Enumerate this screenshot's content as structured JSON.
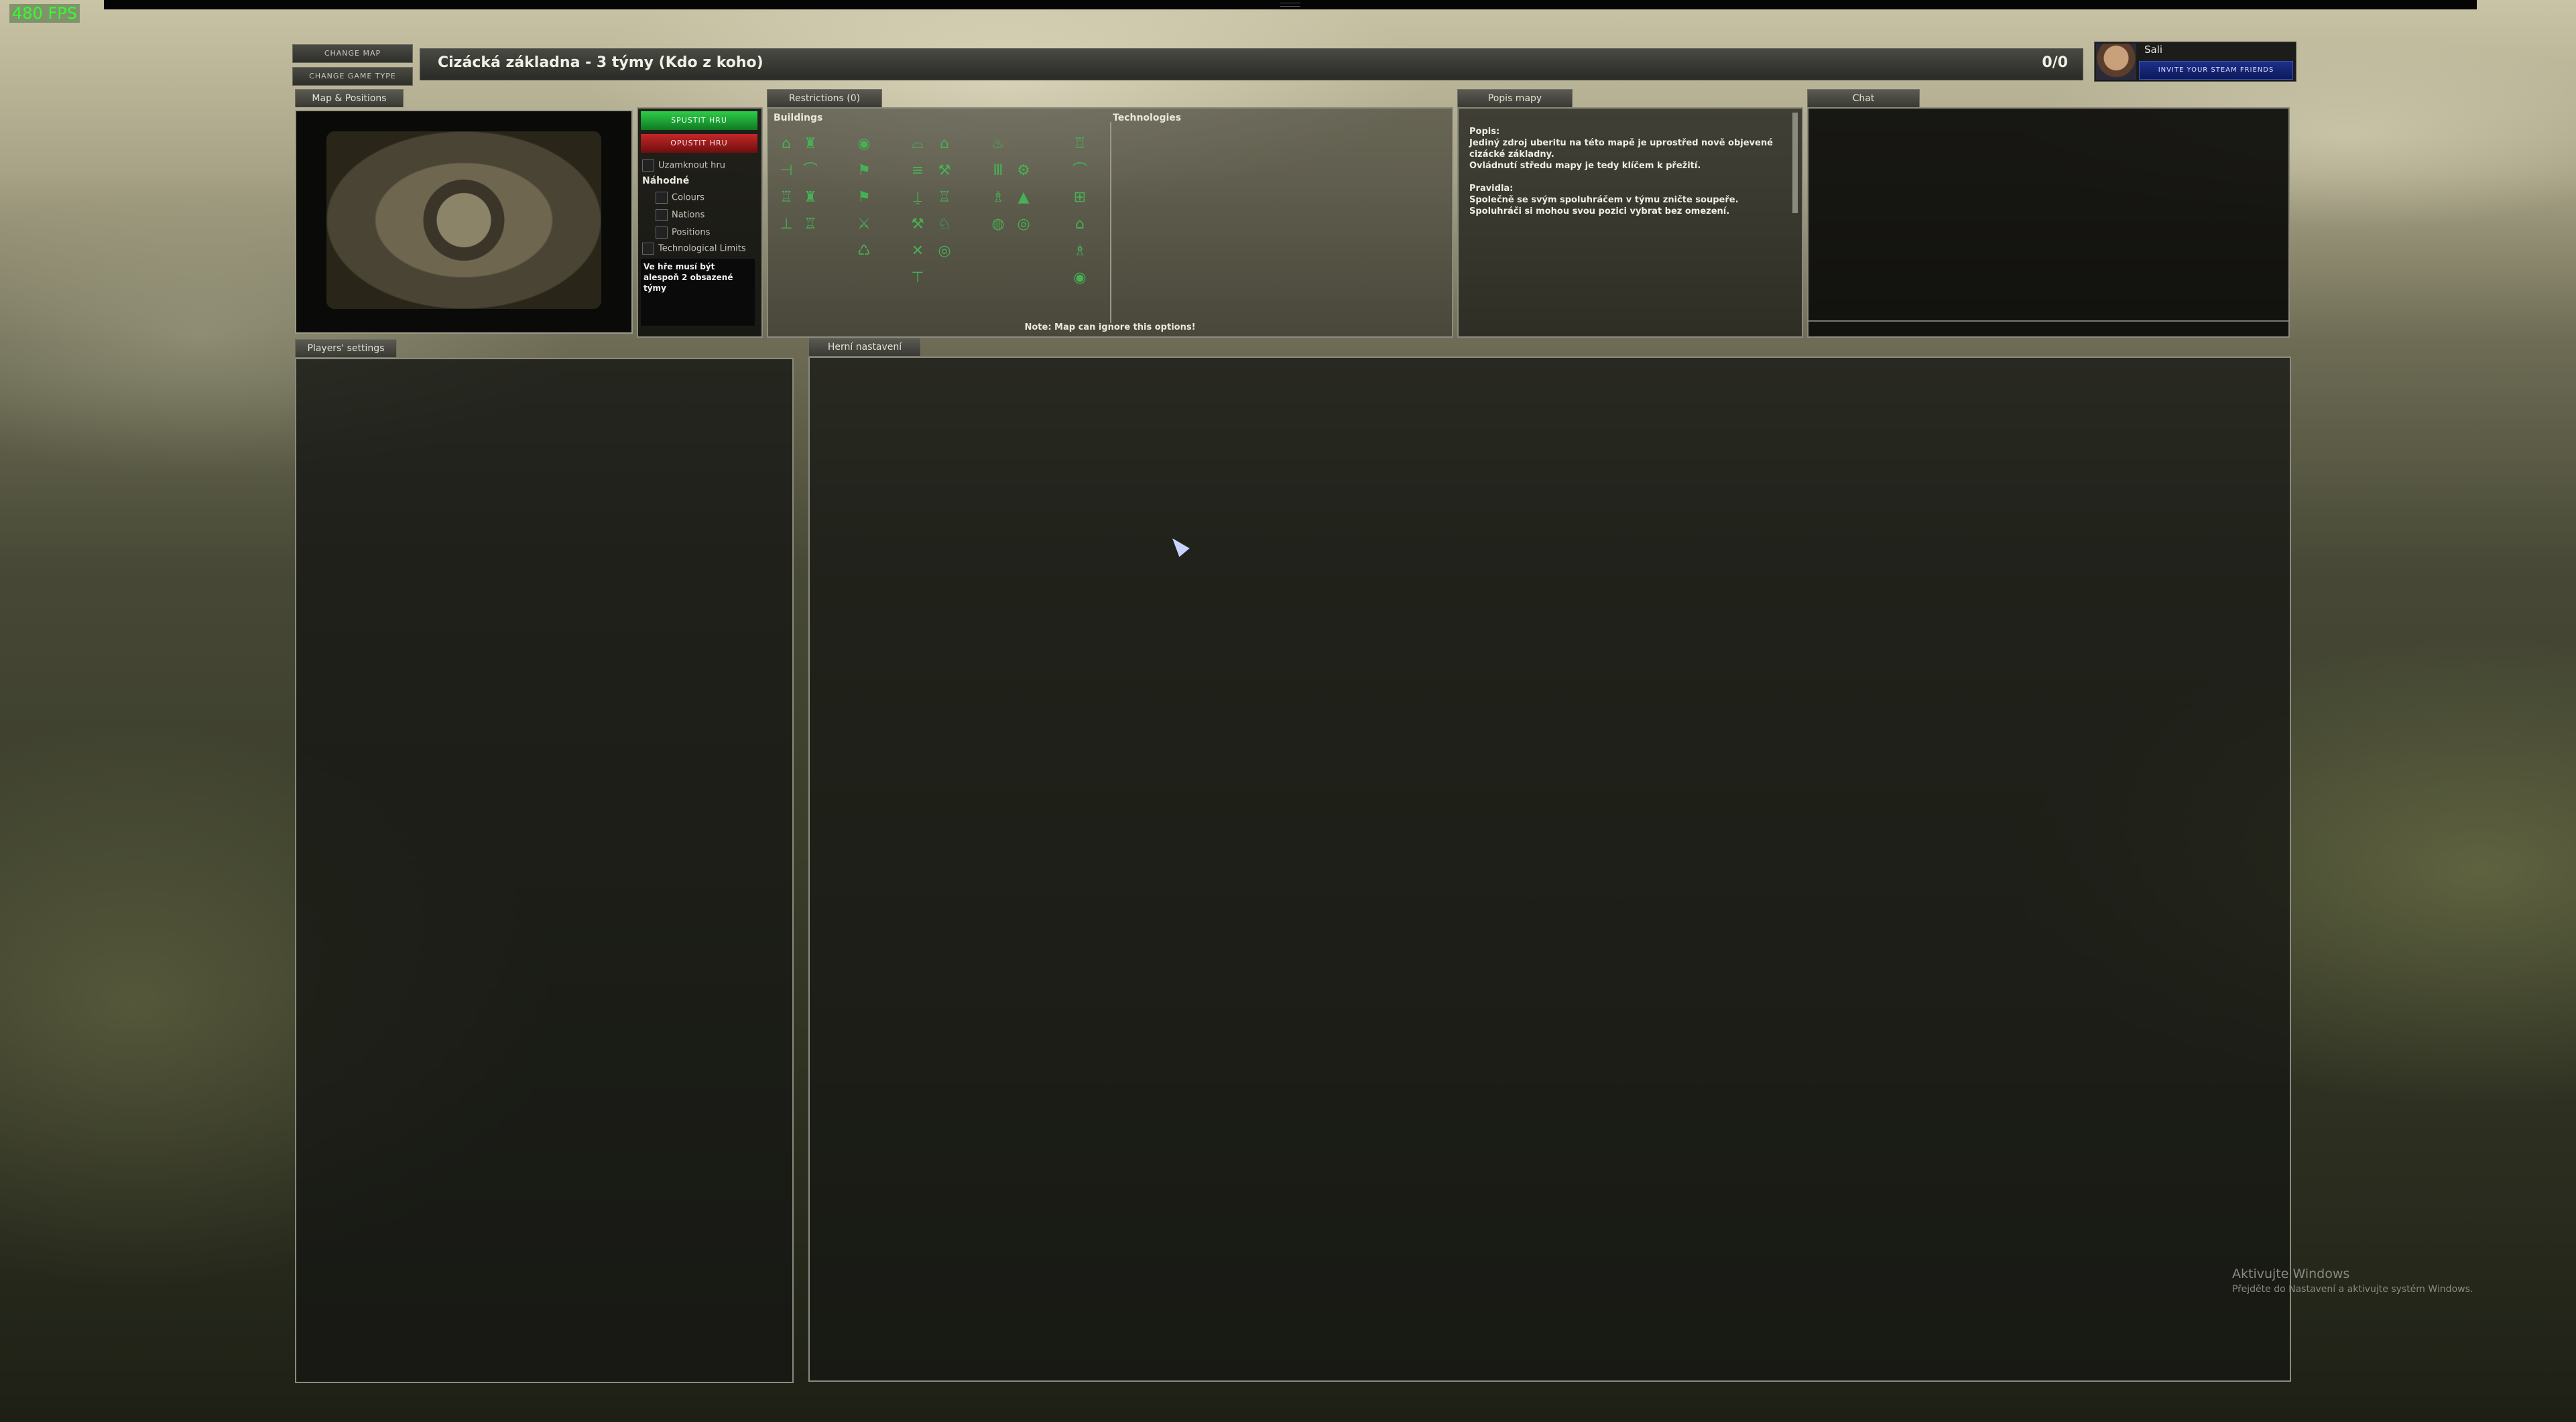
{
  "fps": "480 FPS",
  "side_buttons": {
    "change_map": "CHANGE MAP",
    "change_game_type": "CHANGE GAME TYPE"
  },
  "title": "Cizácká základna -   3 týmy (Kdo z koho)",
  "player_count": "0/0",
  "profile": {
    "name": "Sali",
    "invite": "INVITE YOUR STEAM FRIENDS"
  },
  "tabs": {
    "map_positions": "Map & Positions",
    "restrictions": "Restrictions (0)",
    "popis": "Popis mapy",
    "chat": "Chat",
    "players": "Players' settings",
    "herni": "Herní nastavení"
  },
  "controls": {
    "start": "SPUSTIT HRU",
    "leave": "OPUSTIT HRU",
    "lock": "Uzamknout hru",
    "random_header": "Náhodné",
    "colours": "Colours",
    "nations": "Nations",
    "positions": "Positions",
    "tech_limits": "Technological Limits",
    "requirement": "Ve hře musí být alespoň 2 obsazené týmy"
  },
  "restrictions": {
    "buildings": "Buildings",
    "technologies": "Technologies",
    "note": "Note: Map can ignore this options!"
  },
  "map_description": {
    "text": "Popis:\nJediný zdroj uberitu na této mapě je uprostřed nově objevené cizácké základny.\nOvládnutí středu mapy je tedy klíčem k přežití.\n\nPravidla:\nSpolečně se svým spoluhráčem v týmu zničte soupeře.\nSpoluhráči si mohou svou pozici vybrat bez omezení."
  },
  "windows": {
    "line1": "Aktivujte Windows",
    "line2": "Přejděte do Nastavení a aktivujte systém Windows."
  },
  "icon_color": "#47b055"
}
